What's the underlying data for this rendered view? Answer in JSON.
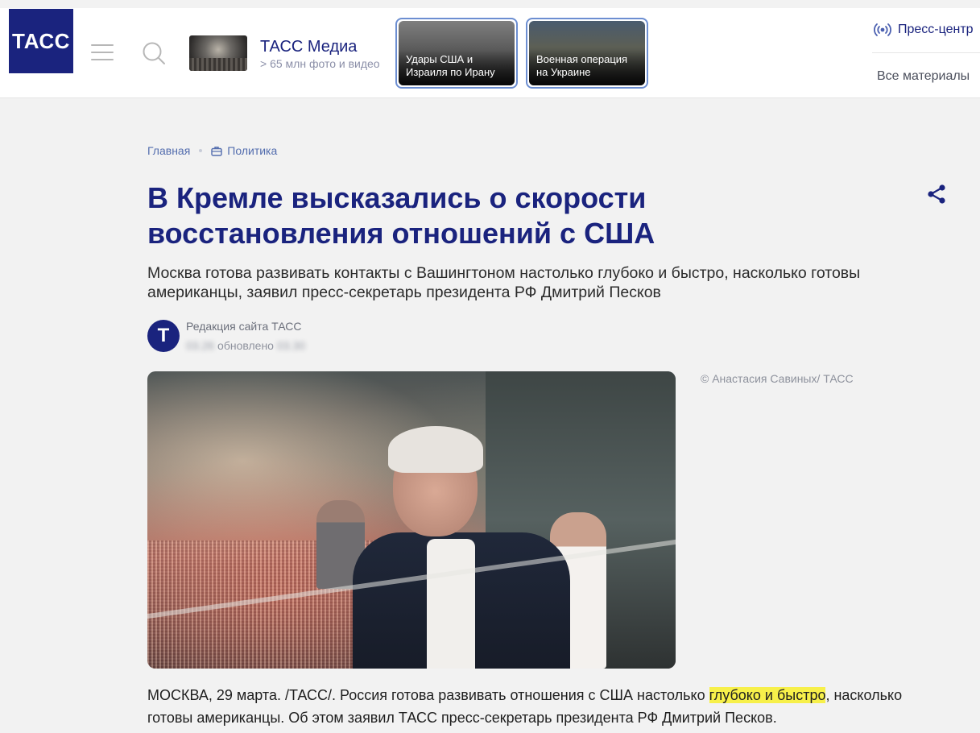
{
  "header": {
    "logo_text": "ТАСС",
    "media": {
      "title": "ТАСС Медиа",
      "subtitle": "> 65 млн фото и видео"
    },
    "stories": [
      {
        "label": "Удары США и Израиля по Ирану"
      },
      {
        "label": "Военная операция на Украине"
      }
    ],
    "press_center": "Пресс-центр",
    "all_materials": "Все материалы"
  },
  "breadcrumb": {
    "home": "Главная",
    "section": "Политика"
  },
  "article": {
    "title": "В Кремле высказались о скорости восстановления отношений с США",
    "lead": "Москва готова развивать контакты с Вашингтоном настолько глубоко и быстро, насколько готовы американцы, заявил пресс-секретарь президента РФ Дмитрий Песков",
    "author_initial": "Т",
    "author": "Редакция сайта ТАСС",
    "published_date": "03.26",
    "updated_label": "обновлено",
    "updated_time": "03.30",
    "photo_credit": "© Анастасия Савиных/ ТАСС",
    "body_before": "МОСКВА, 29 марта. /ТАСС/. Россия готова развивать отношения с США настолько ",
    "body_highlight": "глубоко и быстро",
    "body_after": ", насколько готовы американцы. Об этом заявил ТАСС пресс-секретарь президента РФ Дмитрий Песков."
  },
  "colors": {
    "brand": "#1a237e",
    "link": "#536dae",
    "highlight": "#f7f04a",
    "story_border": "#6c8ed1"
  },
  "icons": [
    "menu-icon",
    "search-icon",
    "broadcast-icon",
    "briefcase-icon",
    "share-icon"
  ]
}
